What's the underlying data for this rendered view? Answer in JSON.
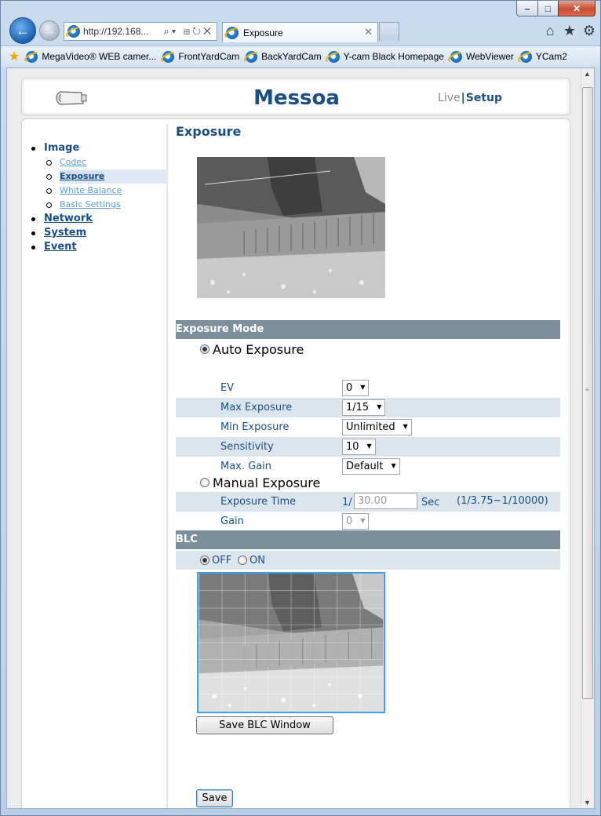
{
  "browser": {
    "address": "http://192.168...",
    "tab_title": "Exposure",
    "favorites": [
      "MegaVideo® WEB camer...",
      "FrontYardCam",
      "BackYardCam",
      "Y-cam Black Homepage",
      "WebViewer",
      "YCam2"
    ]
  },
  "header": {
    "brand": "Messoa",
    "live": "Live",
    "separator": "|",
    "setup": "Setup"
  },
  "sidebar": {
    "image": "Image",
    "sub_items": [
      "Codec",
      "Exposure",
      "White Balance",
      "Basic Settings"
    ],
    "network": "Network",
    "system": "System",
    "event": "Event"
  },
  "page": {
    "title": "Exposure",
    "exposure_mode_header": "Exposure Mode",
    "auto_exposure": "Auto Exposure",
    "manual_exposure": "Manual Exposure",
    "blc_header": "BLC",
    "blc_off": "OFF",
    "blc_on": "ON",
    "save_blc_button": "Save BLC Window",
    "save_button": "Save"
  },
  "auto_settings": [
    {
      "label": "EV",
      "value": "0"
    },
    {
      "label": "Max Exposure",
      "value": "1/15"
    },
    {
      "label": "Min Exposure",
      "value": "Unlimited"
    },
    {
      "label": "Sensitivity",
      "value": "10"
    },
    {
      "label": "Max. Gain",
      "value": "Default"
    }
  ],
  "manual_settings": {
    "exposure_time_label": "Exposure Time",
    "prefix": "1/",
    "exposure_time_value": "30.00",
    "unit": "Sec",
    "range": "(1/3.75~1/10000)",
    "gain_label": "Gain",
    "gain_value": "0"
  },
  "state": {
    "mode": "auto",
    "blc": "off"
  },
  "colors": {
    "brand": "#1a4f84",
    "section_bar": "#7c8f9c",
    "row_shade": "#dbe5ee",
    "link": "#5e9bd1",
    "blc_frame": "#3ba0e6"
  }
}
